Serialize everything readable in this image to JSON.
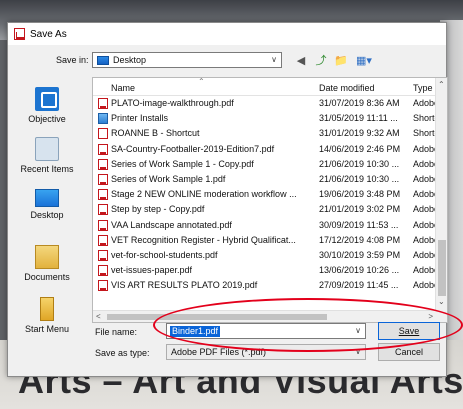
{
  "background": {
    "poster_text": "Arts – Art and Visual Arts",
    "poster_top_text": "g"
  },
  "dialog": {
    "title": "Save As",
    "save_in_label": "Save in:",
    "save_in_value": "Desktop",
    "toolbar_icons": [
      "back-icon",
      "up-folder-icon",
      "new-folder-icon",
      "views-menu-icon"
    ]
  },
  "places": [
    {
      "label": "Objective",
      "icon": "quick-access-icon"
    },
    {
      "label": "Recent Items",
      "icon": "recent-items-icon"
    },
    {
      "label": "Desktop",
      "icon": "desktop-icon"
    },
    {
      "label": "Documents",
      "icon": "documents-icon"
    },
    {
      "label": "Start Menu",
      "icon": "start-menu-icon"
    }
  ],
  "file_list": {
    "columns": {
      "name": "Name",
      "date": "Date modified",
      "type": "Type"
    },
    "rows": [
      {
        "name": "PLATO-image-walkthrough.pdf",
        "date": "31/07/2019 8:36 AM",
        "type": "Adobe",
        "icon": "pdf"
      },
      {
        "name": "Printer Installs",
        "date": "31/05/2019 11:11 ...",
        "type": "Shortc",
        "icon": "printer"
      },
      {
        "name": "ROANNE B - Shortcut",
        "date": "31/01/2019 9:32 AM",
        "type": "Shortc",
        "icon": "shortcut"
      },
      {
        "name": "SA-Country-Footballer-2019-Edition7.pdf",
        "date": "14/06/2019 2:46 PM",
        "type": "Adobe",
        "icon": "pdf"
      },
      {
        "name": "Series of Work Sample 1 - Copy.pdf",
        "date": "21/06/2019 10:30 ...",
        "type": "Adobe",
        "icon": "pdf"
      },
      {
        "name": "Series of Work Sample 1.pdf",
        "date": "21/06/2019 10:30 ...",
        "type": "Adobe",
        "icon": "pdf"
      },
      {
        "name": "Stage 2 NEW ONLINE moderation workflow ...",
        "date": "19/06/2019 3:48 PM",
        "type": "Adobe",
        "icon": "pdf"
      },
      {
        "name": "Step by step - Copy.pdf",
        "date": "21/01/2019 3:02 PM",
        "type": "Adobe",
        "icon": "pdf"
      },
      {
        "name": "VAA Landscape annotated.pdf",
        "date": "30/09/2019 11:53 ...",
        "type": "Adobe",
        "icon": "pdf"
      },
      {
        "name": "VET Recognition Register - Hybrid Qualificat...",
        "date": "17/12/2019 4:08 PM",
        "type": "Adobe",
        "icon": "pdf"
      },
      {
        "name": "vet-for-school-students.pdf",
        "date": "30/10/2019 3:59 PM",
        "type": "Adobe",
        "icon": "pdf"
      },
      {
        "name": "vet-issues-paper.pdf",
        "date": "13/06/2019 10:26 ...",
        "type": "Adobe",
        "icon": "pdf"
      },
      {
        "name": "VIS ART RESULTS PLATO 2019.pdf",
        "date": "27/09/2019 11:45 ...",
        "type": "Adobe",
        "icon": "pdf"
      }
    ]
  },
  "form": {
    "file_name_label": "File name:",
    "file_name_value": "Binder1.pdf",
    "save_as_type_label": "Save as type:",
    "save_as_type_value": "Adobe PDF Files (*.pdf)",
    "save_button": "Save",
    "cancel_button": "Cancel"
  },
  "colors": {
    "selection": "#0a64d8",
    "annotation": "#e3001b",
    "pdf_icon": "#c4161c"
  }
}
